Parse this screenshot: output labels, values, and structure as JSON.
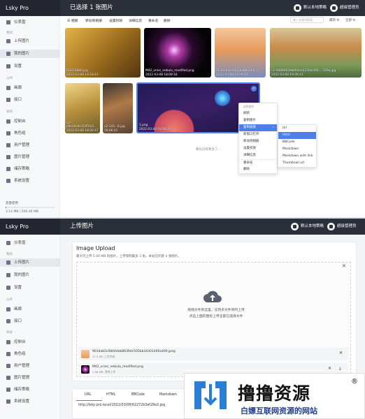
{
  "top": {
    "brand": "Lsky Pro",
    "header_title": "已选择 1 张图片",
    "header_btn1": "默认本地策略",
    "header_btn2": "超级管理员",
    "sidebar": {
      "dashboard": "仪表盘",
      "sec_upload": "我的",
      "upload": "上传图片",
      "my_images": "我的图片",
      "settings": "设置",
      "sec_public": "公共",
      "gallery": "画廊",
      "api": "接口",
      "sec_system": "系统",
      "console": "控制台",
      "roles": "角色组",
      "users": "用户管理",
      "images_admin": "图片管理",
      "strategies": "储存策略",
      "system_settings": "系统设置"
    },
    "storage_label": "容量使用",
    "storage_value": "3.14 MB / 500.00 MB",
    "storage_fraction": 0.006,
    "toolbar": [
      "☰ 相册",
      "移动到相册",
      "设置权限",
      "详细信息",
      "重命名",
      "删除"
    ],
    "search_placeholder": "输入关键字搜索...",
    "sort": "最新 ⇅",
    "filter": "全部 ⇅",
    "tiles": [
      {
        "name": "DSC03880.jpg",
        "date": "2022-03-08 18:18:43"
      },
      {
        "name": "M42_orion_nebula_modified.png",
        "date": "2022-03-08 18:09:16"
      },
      {
        "name": "9034ab5c0844deb8639dc...",
        "date": "2022-03-08 18:09:12"
      },
      {
        "name": "v2-9489d628be64ea423cbc0f9... 720w.jpg",
        "date": "2022-03-08 18:06:41"
      },
      {
        "name": "v2-e8e3dc8c1f3f5fa5...",
        "date": "2022-03-08 18:06:47"
      },
      {
        "name": "v2-1a5...8.jpg",
        "date": "18:06:41"
      },
      {
        "name": "1.png",
        "date": "2022-03-08 18:08:20"
      }
    ],
    "context_menu": [
      "选择操作",
      "刷新",
      "复制图片",
      "复制链接",
      "新窗口打开",
      "移动到相册",
      "设置权限",
      "详细信息",
      "重命名",
      "删除"
    ],
    "submenu": [
      "Url",
      "Html",
      "BBCode",
      "Markdown",
      "Markdown with link",
      "Thumbnail url"
    ],
    "more_text": "要也没有更多了..."
  },
  "bottom": {
    "brand": "Lsky Pro",
    "header_title": "上传图片",
    "header_btn1": "默认本地策略",
    "header_btn2": "超级管理员",
    "sidebar": {
      "dashboard": "仪表盘",
      "sec_upload": "我的",
      "upload": "上传图片",
      "my_images": "我的图片",
      "settings": "设置",
      "sec_public": "公共",
      "gallery": "画廊",
      "api": "接口",
      "sec_system": "系统",
      "console": "控制台",
      "roles": "角色组",
      "users": "用户管理",
      "images_admin": "图片管理",
      "strategies": "储存策略",
      "system_settings": "系统设置"
    },
    "card_title": "Image Upload",
    "card_desc": "最大可上传 5.00 MB 的图片，上传限制最多 3 张。本站已托管 4 张图片。",
    "drop_text1": "拖拽文件到这里，支持多文件同时上传",
    "drop_text2": "点击上面的图标上传全部已选择文件",
    "files": [
      {
        "name": "9034ab5c0844deb8639dc505bb34301400x400.jpeg",
        "meta": "31.3 KB, 上传完成"
      },
      {
        "name": "M42_orion_nebula_modified.png",
        "meta": "1.98 MB, 等待上传"
      }
    ],
    "tabs": [
      "URL",
      "HTML",
      "BBCode",
      "Markdown"
    ],
    "url_value": "http://lsky-pro.local/2022/03/08/62272b3ef28e3.jpg"
  },
  "watermark": {
    "title": "撸撸资源",
    "reg": "®",
    "slogan": "白嫖互联网资源的网站"
  }
}
